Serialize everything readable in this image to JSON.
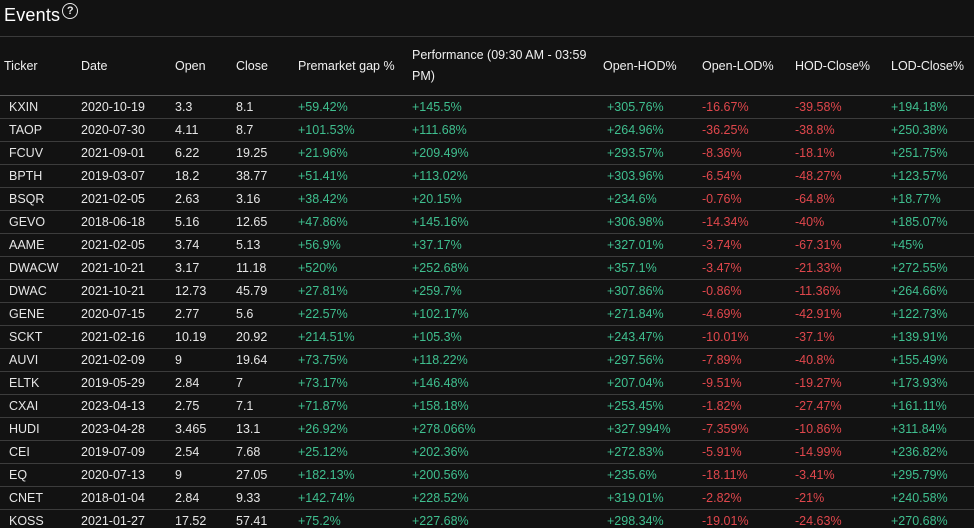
{
  "header": {
    "title": "Events",
    "help_icon": "question-circle-icon"
  },
  "colors": {
    "positive": "#3fbf8f",
    "negative": "#e0474c",
    "background": "#121212"
  },
  "columns": [
    "Ticker",
    "Date",
    "Open",
    "Close",
    "Premarket gap %",
    "Performance (09:30 AM - 03:59 PM)",
    "Open-HOD%",
    "Open-LOD%",
    "HOD-Close%",
    "LOD-Close%"
  ],
  "rows": [
    [
      "KXIN",
      "2020-10-19",
      "3.3",
      "8.1",
      "+59.42%",
      "+145.5%",
      "+305.76%",
      "-16.67%",
      "-39.58%",
      "+194.18%"
    ],
    [
      "TAOP",
      "2020-07-30",
      "4.11",
      "8.7",
      "+101.53%",
      "+111.68%",
      "+264.96%",
      "-36.25%",
      "-38.8%",
      "+250.38%"
    ],
    [
      "FCUV",
      "2021-09-01",
      "6.22",
      "19.25",
      "+21.96%",
      "+209.49%",
      "+293.57%",
      "-8.36%",
      "-18.1%",
      "+251.75%"
    ],
    [
      "BPTH",
      "2019-03-07",
      "18.2",
      "38.77",
      "+51.41%",
      "+113.02%",
      "+303.96%",
      "-6.54%",
      "-48.27%",
      "+123.57%"
    ],
    [
      "BSQR",
      "2021-02-05",
      "2.63",
      "3.16",
      "+38.42%",
      "+20.15%",
      "+234.6%",
      "-0.76%",
      "-64.8%",
      "+18.77%"
    ],
    [
      "GEVO",
      "2018-06-18",
      "5.16",
      "12.65",
      "+47.86%",
      "+145.16%",
      "+306.98%",
      "-14.34%",
      "-40%",
      "+185.07%"
    ],
    [
      "AAME",
      "2021-02-05",
      "3.74",
      "5.13",
      "+56.9%",
      "+37.17%",
      "+327.01%",
      "-3.74%",
      "-67.31%",
      "+45%"
    ],
    [
      "DWACW",
      "2021-10-21",
      "3.17",
      "11.18",
      "+520%",
      "+252.68%",
      "+357.1%",
      "-3.47%",
      "-21.33%",
      "+272.55%"
    ],
    [
      "DWAC",
      "2021-10-21",
      "12.73",
      "45.79",
      "+27.81%",
      "+259.7%",
      "+307.86%",
      "-0.86%",
      "-11.36%",
      "+264.66%"
    ],
    [
      "GENE",
      "2020-07-15",
      "2.77",
      "5.6",
      "+22.57%",
      "+102.17%",
      "+271.84%",
      "-4.69%",
      "-42.91%",
      "+122.73%"
    ],
    [
      "SCKT",
      "2021-02-16",
      "10.19",
      "20.92",
      "+214.51%",
      "+105.3%",
      "+243.47%",
      "-10.01%",
      "-37.1%",
      "+139.91%"
    ],
    [
      "AUVI",
      "2021-02-09",
      "9",
      "19.64",
      "+73.75%",
      "+118.22%",
      "+297.56%",
      "-7.89%",
      "-40.8%",
      "+155.49%"
    ],
    [
      "ELTK",
      "2019-05-29",
      "2.84",
      "7",
      "+73.17%",
      "+146.48%",
      "+207.04%",
      "-9.51%",
      "-19.27%",
      "+173.93%"
    ],
    [
      "CXAI",
      "2023-04-13",
      "2.75",
      "7.1",
      "+71.87%",
      "+158.18%",
      "+253.45%",
      "-1.82%",
      "-27.47%",
      "+161.11%"
    ],
    [
      "HUDI",
      "2023-04-28",
      "3.465",
      "13.1",
      "+26.92%",
      "+278.066%",
      "+327.994%",
      "-7.359%",
      "-10.86%",
      "+311.84%"
    ],
    [
      "CEI",
      "2019-07-09",
      "2.54",
      "7.68",
      "+25.12%",
      "+202.36%",
      "+272.83%",
      "-5.91%",
      "-14.99%",
      "+236.82%"
    ],
    [
      "EQ",
      "2020-07-13",
      "9",
      "27.05",
      "+182.13%",
      "+200.56%",
      "+235.6%",
      "-18.11%",
      "-3.41%",
      "+295.79%"
    ],
    [
      "CNET",
      "2018-01-04",
      "2.84",
      "9.33",
      "+142.74%",
      "+228.52%",
      "+319.01%",
      "-2.82%",
      "-21%",
      "+240.58%"
    ],
    [
      "KOSS",
      "2021-01-27",
      "17.52",
      "57.41",
      "+75.2%",
      "+227.68%",
      "+298.34%",
      "-19.01%",
      "-24.63%",
      "+270.68%"
    ]
  ]
}
